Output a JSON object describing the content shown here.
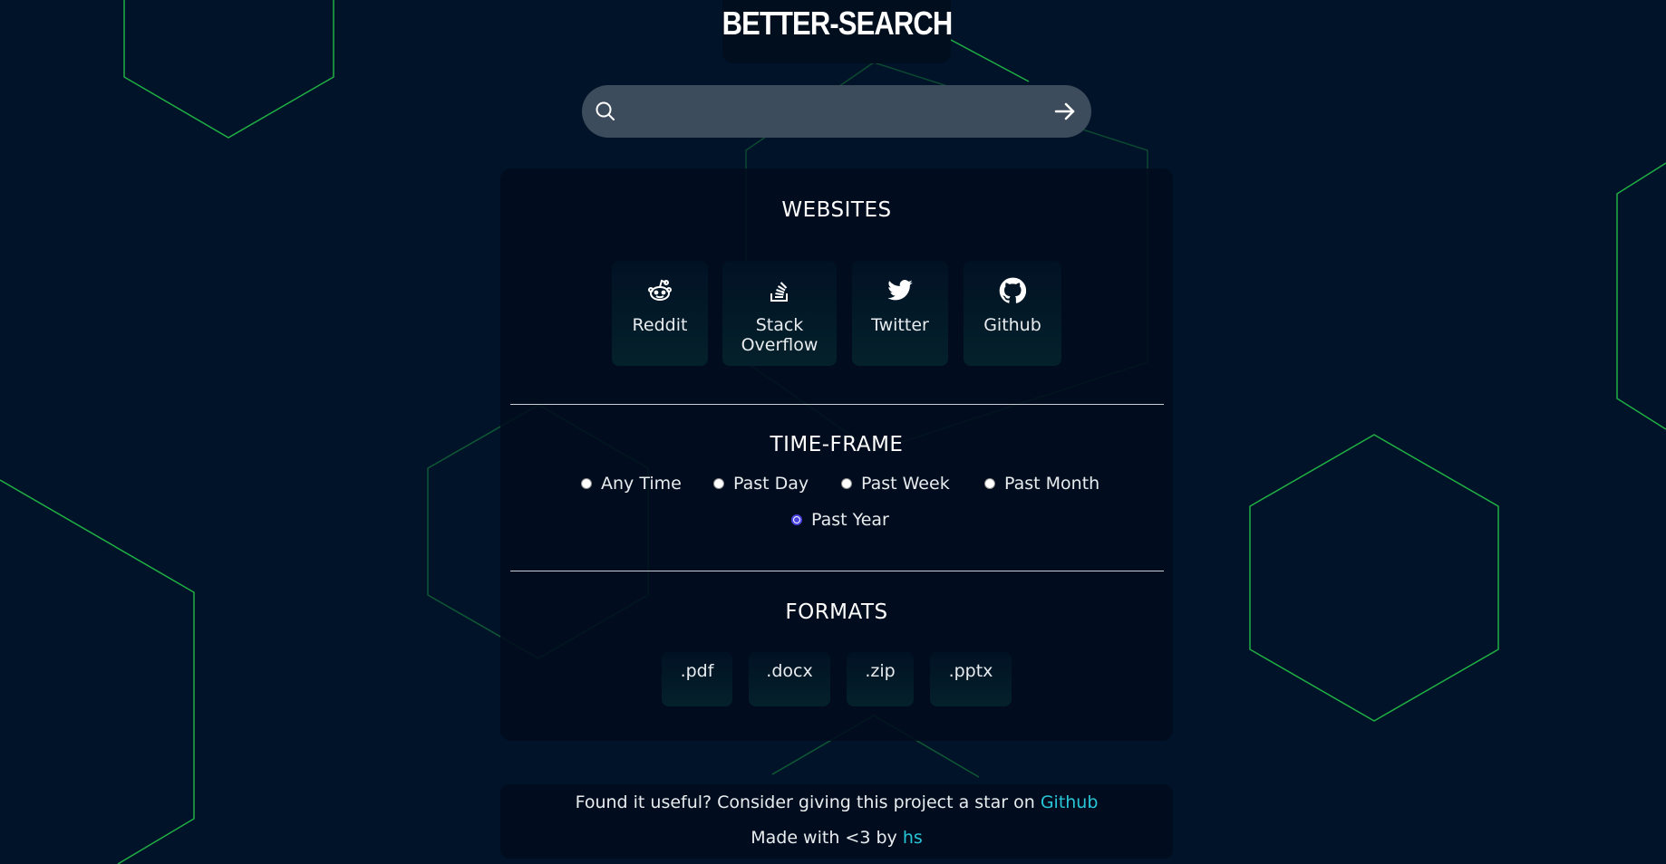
{
  "app": {
    "title": "BETTER-SEARCH"
  },
  "search": {
    "placeholder": "",
    "value": ""
  },
  "sections": {
    "websites": "WEBSITES",
    "timeframe": "TIME-FRAME",
    "formats": "FORMATS"
  },
  "websites": [
    {
      "label": "Reddit",
      "icon": "reddit-icon"
    },
    {
      "label": "Stack\nOverflow",
      "icon": "stack-overflow-icon"
    },
    {
      "label": "Twitter",
      "icon": "twitter-icon"
    },
    {
      "label": "Github",
      "icon": "github-icon"
    }
  ],
  "timeframes": [
    {
      "label": "Any Time",
      "checked": false
    },
    {
      "label": "Past Day",
      "checked": false
    },
    {
      "label": "Past Week",
      "checked": false
    },
    {
      "label": "Past Month",
      "checked": false
    },
    {
      "label": "Past Year",
      "checked": true
    }
  ],
  "formats": [
    ".pdf",
    ".docx",
    ".zip",
    ".pptx"
  ],
  "footer": {
    "line1_text": "Found it useful? Consider giving this project a star on ",
    "line1_link": "Github",
    "line2_text": "Made with <3 by ",
    "line2_link": "hs"
  },
  "colors": {
    "background": "#011329",
    "hex_stroke": "#1fb043",
    "link": "#27c6d8",
    "radio_checked": "#4a43e0"
  }
}
